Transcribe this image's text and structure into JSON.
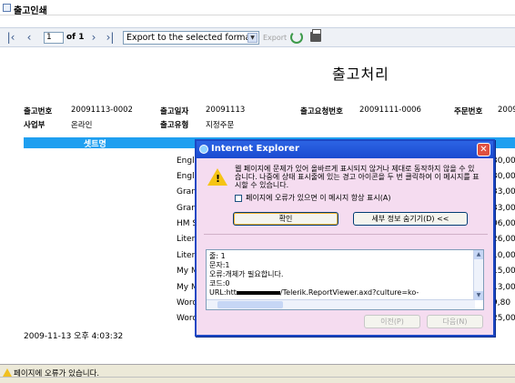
{
  "window": {
    "title": "출고인쇄"
  },
  "toolbar": {
    "page_value": "1",
    "page_of_label": "of 1",
    "export_format": "Export to the selected format",
    "export_label": "Export"
  },
  "report": {
    "title": "출고처리",
    "fields": [
      {
        "label": "출고번호",
        "value": "20091113-0002"
      },
      {
        "label": "출고일자",
        "value": "20091113"
      },
      {
        "label": "출고요청번호",
        "value": "20091111-0006"
      },
      {
        "label": "주문번호",
        "value": "2009"
      },
      {
        "label": "사업부",
        "value": "온라인"
      },
      {
        "label": "출고유형",
        "value": "지정주문"
      }
    ],
    "column_header": "셋트명",
    "rows_left": [
      "Engl",
      "Engl",
      "Gran",
      "Gran",
      "HM S",
      "Litera",
      "Litera",
      "My M",
      "My M",
      "Word",
      "Word"
    ],
    "rows_right": [
      "30,00",
      "30,00",
      "33,00",
      "33,00",
      "06,00",
      "26,00",
      "10,00",
      "15,00",
      "13,00",
      "9,80",
      "25,00"
    ],
    "timestamp": "2009-11-13 오후 4:03:32"
  },
  "statusbar": {
    "text": "페이지에 오류가 있습니다."
  },
  "dialog": {
    "title": "Internet Explorer",
    "message": "웹 페이지에 문제가 있어 올바르게 표시되지 않거나 제대로 동작하지 않을 수 있습니다. 나중에 상태 표시줄에 있는 경고 아이콘을 두 번 클릭하여 이 메시지를 표시할 수 있습니다.",
    "checkbox_label": "페이지에 오류가 있으면 이 메시지 항상 표시(A)",
    "ok_label": "확인",
    "details_label": "세부 정보 숨기기(D) <<",
    "details": {
      "line1": "줄:  1",
      "line2": "문자:1",
      "line3": "오류:개체가 필요합니다.",
      "line4": "코드:0",
      "line5_prefix": "URL:htt",
      "line5_suffix": "/Telerik.ReportViewer.axd?culture=ko-"
    },
    "prev_label": "이전(P)",
    "next_label": "다음(N)"
  }
}
